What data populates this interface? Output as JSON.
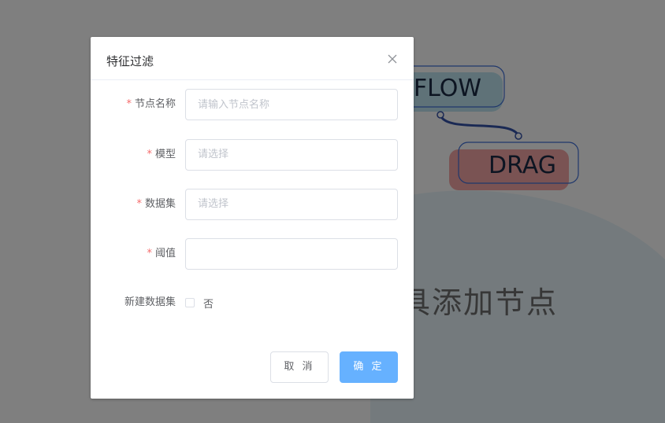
{
  "background": {
    "nodes": [
      {
        "label": "FLOW"
      },
      {
        "label": "DRAG"
      }
    ],
    "hint_text": "具添加节点"
  },
  "dialog": {
    "title": "特征过滤",
    "fields": [
      {
        "label": "节点名称",
        "required": true,
        "type": "input",
        "placeholder": "请输入节点名称",
        "value": ""
      },
      {
        "label": "模型",
        "required": true,
        "type": "select",
        "placeholder": "请选择"
      },
      {
        "label": "数据集",
        "required": true,
        "type": "select",
        "placeholder": "请选择"
      },
      {
        "label": "阈值",
        "required": true,
        "type": "input",
        "placeholder": "",
        "value": ""
      },
      {
        "label": "新建数据集",
        "required": false,
        "type": "checkbox",
        "option_label": "否",
        "checked": false
      }
    ],
    "cancel_label": "取 消",
    "confirm_label": "确 定"
  },
  "colors": {
    "primary": "#66b1ff",
    "required": "#f56c6c",
    "overlay": "#000000"
  },
  "icons": {
    "close": "close-icon"
  }
}
